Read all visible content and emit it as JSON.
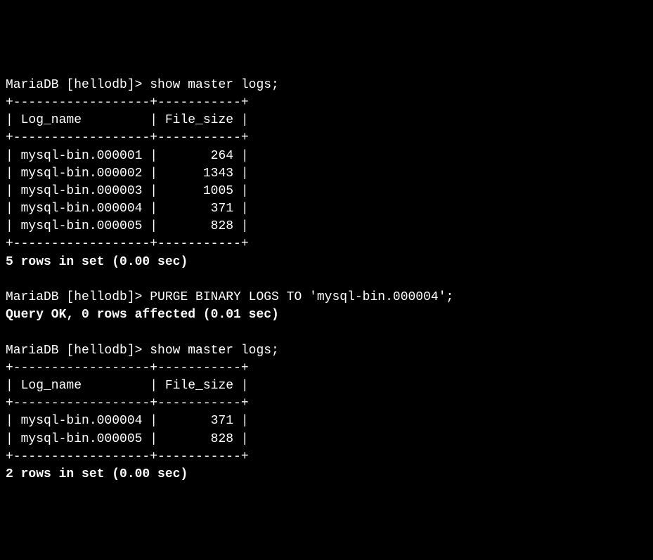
{
  "block1": {
    "prompt": "MariaDB [hellodb]> show master logs;",
    "sep_top": "+------------------+-----------+",
    "header": "| Log_name         | File_size |",
    "sep_mid": "+------------------+-----------+",
    "rows": [
      "| mysql-bin.000001 |       264 |",
      "| mysql-bin.000002 |      1343 |",
      "| mysql-bin.000003 |      1005 |",
      "| mysql-bin.000004 |       371 |",
      "| mysql-bin.000005 |       828 |"
    ],
    "sep_bot": "+------------------+-----------+",
    "summary": "5 rows in set (0.00 sec)"
  },
  "block2": {
    "prompt": "MariaDB [hellodb]> PURGE BINARY LOGS TO 'mysql-bin.000004';",
    "result": "Query OK, 0 rows affected (0.01 sec)"
  },
  "block3": {
    "prompt": "MariaDB [hellodb]> show master logs;",
    "sep_top": "+------------------+-----------+",
    "header": "| Log_name         | File_size |",
    "sep_mid": "+------------------+-----------+",
    "rows": [
      "| mysql-bin.000004 |       371 |",
      "| mysql-bin.000005 |       828 |"
    ],
    "sep_bot": "+------------------+-----------+",
    "summary": "2 rows in set (0.00 sec)"
  }
}
